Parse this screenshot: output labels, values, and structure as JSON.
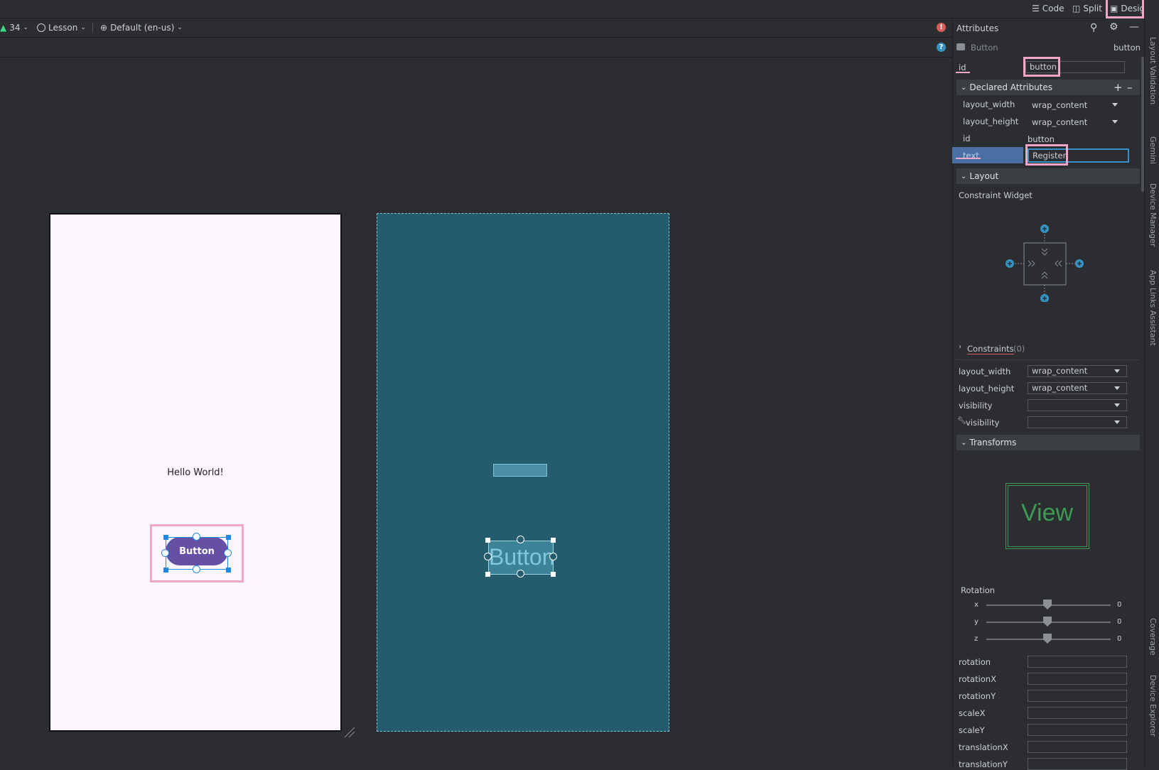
{
  "modebar": {
    "code": "Code",
    "split": "Split",
    "design": "Design"
  },
  "toolbar": {
    "api": "34",
    "theme": "Lesson",
    "locale": "Default (en-us)"
  },
  "design": {
    "hello_text": "Hello World!",
    "button_text": "Button",
    "blueprint_button_text": "Button"
  },
  "attributes": {
    "title": "Attributes",
    "widget_type": "Button",
    "widget_id": "button",
    "id_label": "id",
    "id_value": "button",
    "declared": {
      "title": "Declared Attributes",
      "rows": [
        {
          "name": "layout_width",
          "value": "wrap_content"
        },
        {
          "name": "layout_height",
          "value": "wrap_content"
        },
        {
          "name": "id",
          "value": "button"
        },
        {
          "name": "text",
          "value": "Register"
        }
      ]
    },
    "layout": {
      "title": "Layout",
      "subtitle": "Constraint Widget",
      "constraints_label": "Constraints",
      "constraints_count": "(0)",
      "rows": [
        {
          "name": "layout_width",
          "value": "wrap_content"
        },
        {
          "name": "layout_height",
          "value": "wrap_content"
        },
        {
          "name": "visibility",
          "value": ""
        },
        {
          "name": "visibility",
          "value": ""
        }
      ]
    },
    "transforms": {
      "title": "Transforms",
      "preview_text": "View",
      "rotation_label": "Rotation",
      "axes": [
        {
          "axis": "x",
          "value": "0"
        },
        {
          "axis": "y",
          "value": "0"
        },
        {
          "axis": "z",
          "value": "0"
        }
      ],
      "fields": [
        "rotation",
        "rotationX",
        "rotationY",
        "scaleX",
        "scaleY",
        "translationX",
        "translationY"
      ]
    }
  },
  "side_tabs": [
    "Layout Validation",
    "Gemini",
    "Device Manager",
    "App Links Assistant",
    "Coverage",
    "Device Explorer"
  ]
}
